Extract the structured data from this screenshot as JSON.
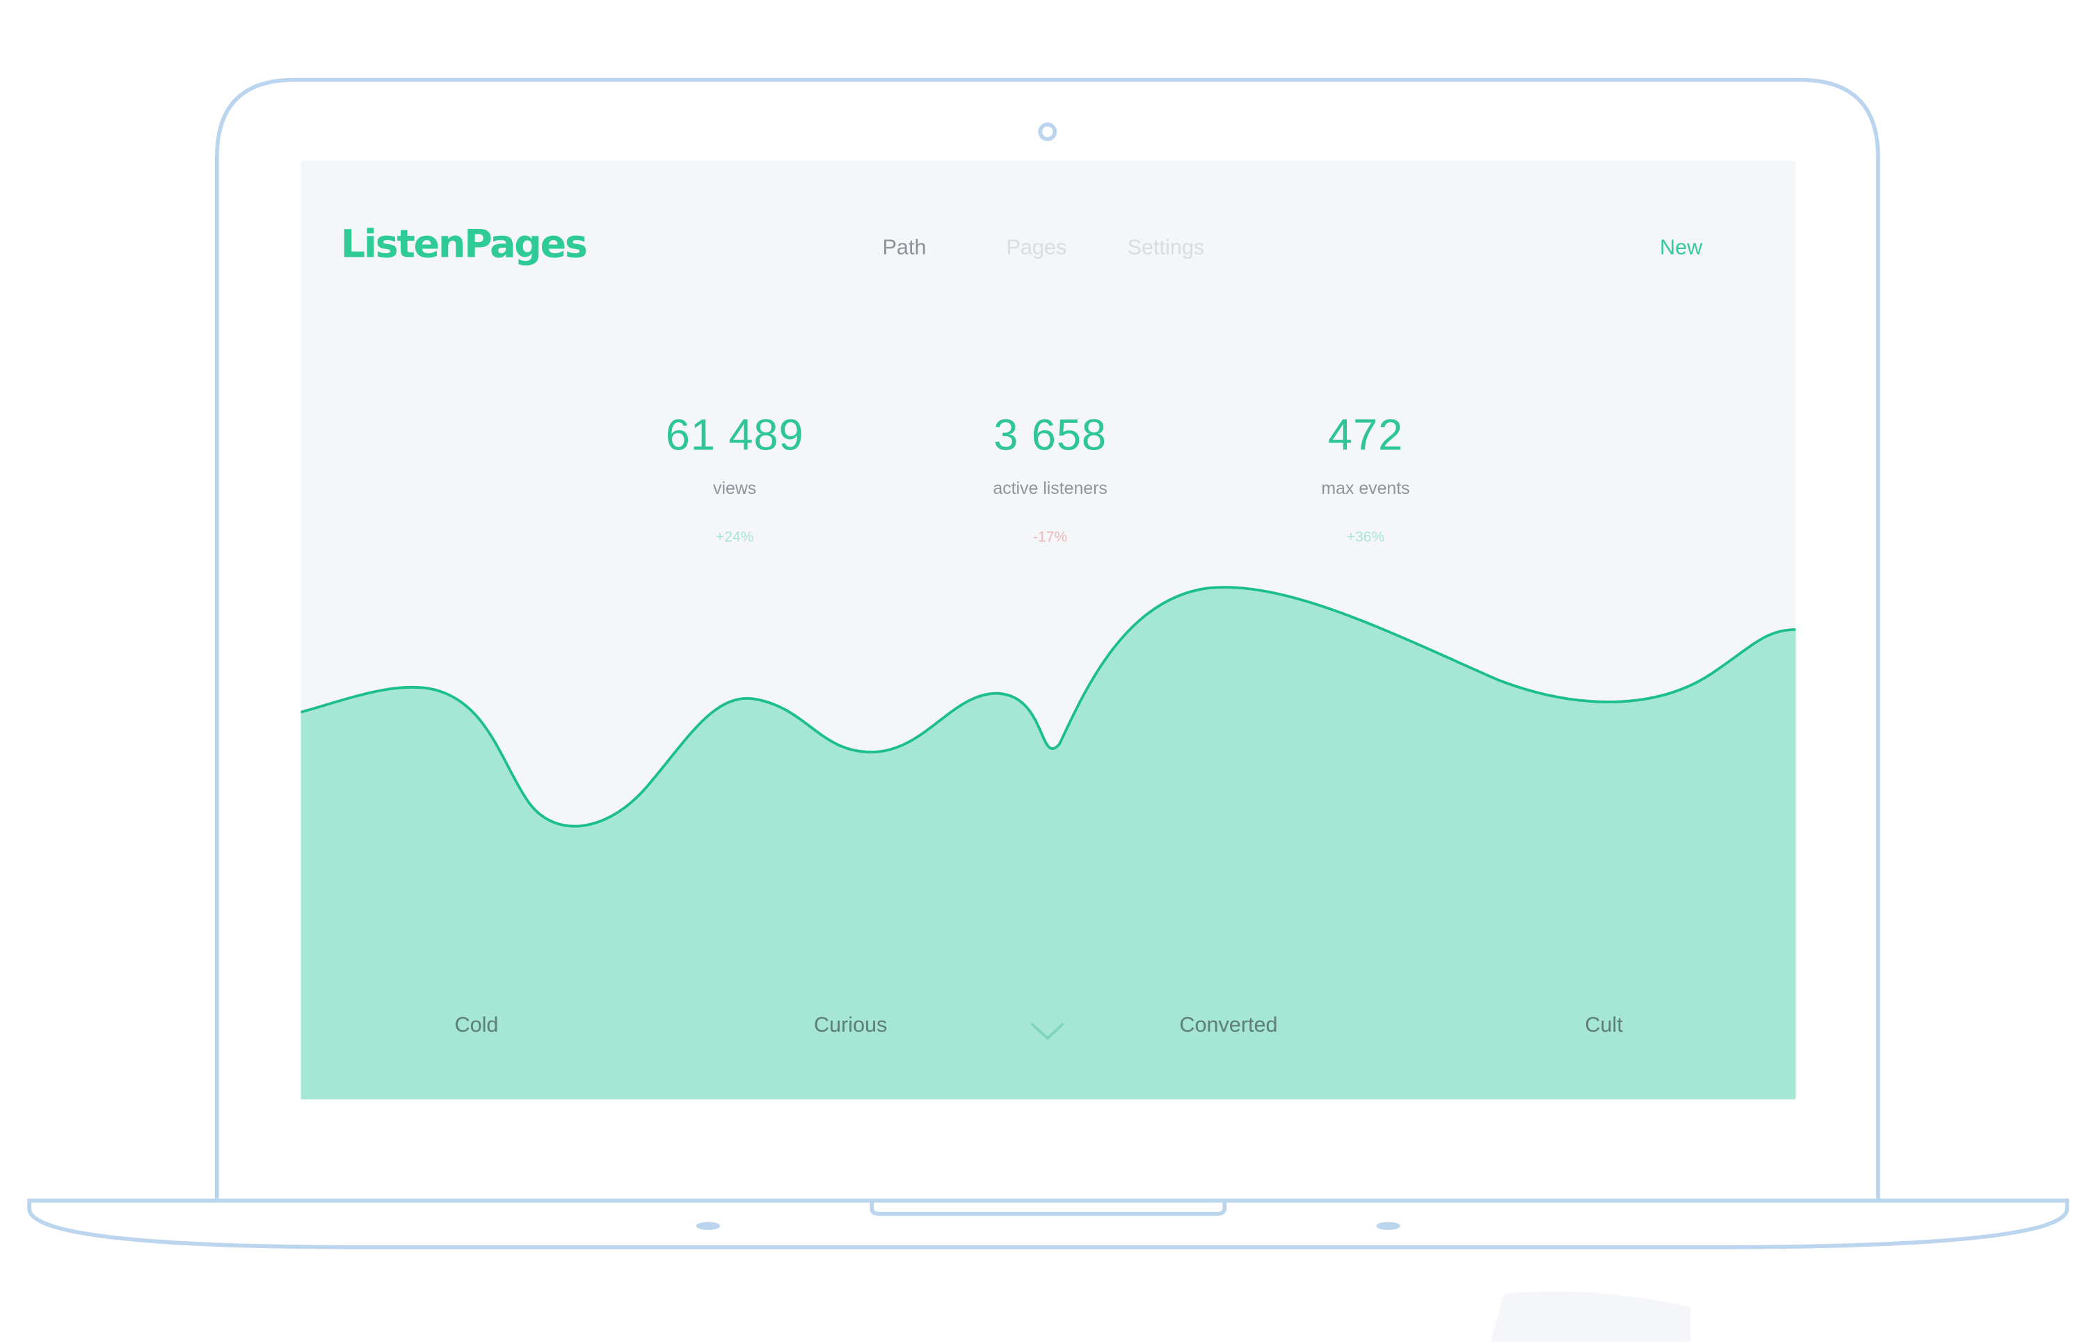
{
  "app": {
    "name": "ListenPages"
  },
  "nav": {
    "items": [
      {
        "label": "Path",
        "active": true
      },
      {
        "label": "Pages",
        "active": false
      },
      {
        "label": "Settings",
        "active": false
      }
    ],
    "new_label": "New"
  },
  "stats": [
    {
      "value": "61 489",
      "label": "views",
      "change": "+24%",
      "trend": "up"
    },
    {
      "value": "3 658",
      "label": "active listeners",
      "change": "-17%",
      "trend": "down"
    },
    {
      "value": "472",
      "label": "max events",
      "change": "+36%",
      "trend": "up"
    }
  ],
  "funnel": {
    "stages": [
      "Cold",
      "Curious",
      "Converted",
      "Cult"
    ]
  },
  "icons": {
    "scroll": "chevron-down-icon",
    "camera": "webcam-icon"
  },
  "colors": {
    "accent": "#2fcb96",
    "area_fill": "#a5e6d5",
    "area_stroke": "#1dbf88",
    "negative": "#f0b8b8",
    "device_outline": "#bcd5ee",
    "screen_bg": "#f4f6f9"
  }
}
